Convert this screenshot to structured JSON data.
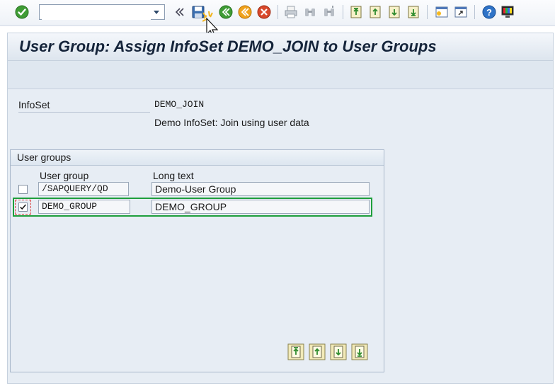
{
  "toolbar": {
    "command_field": {
      "value": "",
      "placeholder": ""
    },
    "icons": [
      "enter-icon",
      "command-dropdown-icon",
      "collapse-arrows-icon",
      "save-icon",
      "back-icon",
      "exit-icon",
      "cancel-icon",
      "print-icon",
      "find-icon",
      "find-next-icon",
      "first-page-icon",
      "previous-page-icon",
      "next-page-icon",
      "last-page-icon",
      "new-session-icon",
      "shortcut-icon",
      "help-icon",
      "customize-layout-icon"
    ]
  },
  "title": {
    "text": "User Group: Assign InfoSet DEMO_JOIN to User Groups"
  },
  "infoset": {
    "label": "InfoSet",
    "value": "DEMO_JOIN",
    "description": "Demo InfoSet: Join using user data"
  },
  "user_groups": {
    "title": "User groups",
    "columns": {
      "group": "User group",
      "long_text": "Long text"
    },
    "rows": [
      {
        "checked": false,
        "group": "/SAPQUERY/QD",
        "long_text": "Demo-User Group"
      },
      {
        "checked": true,
        "group": "DEMO_GROUP",
        "long_text": "DEMO_GROUP"
      }
    ],
    "nav_icons": [
      "first-page-icon",
      "previous-page-icon",
      "next-page-icon",
      "last-page-icon"
    ]
  },
  "colors": {
    "highlight": "#1e9f3c",
    "title_text": "#15243a",
    "panel_bg": "#e7edf4"
  }
}
